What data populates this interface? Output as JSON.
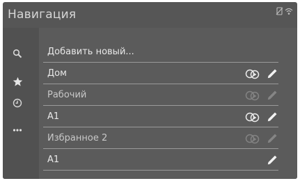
{
  "header": {
    "title": "Навигация",
    "status_icons": [
      "phone-off-icon",
      "wifi-icon"
    ]
  },
  "rail": {
    "items": [
      {
        "icon": "search-icon"
      },
      {
        "icon": "star-icon",
        "active": true
      },
      {
        "icon": "history-icon"
      },
      {
        "icon": "more-icon"
      }
    ]
  },
  "list": {
    "items": [
      {
        "label": "Добавить новый...",
        "actions": []
      },
      {
        "label": "Дом",
        "actions": [
          "connect-icon",
          "edit-icon"
        ],
        "enabled": true
      },
      {
        "label": "Рабочий",
        "actions": [
          "connect-icon",
          "edit-icon"
        ],
        "enabled": false
      },
      {
        "label": "A1",
        "actions": [
          "connect-icon",
          "edit-icon"
        ],
        "enabled": true
      },
      {
        "label": "Избранное 2",
        "actions": [
          "connect-icon",
          "edit-icon"
        ],
        "enabled": false
      },
      {
        "label": "A1",
        "actions": [
          "edit-icon"
        ],
        "enabled": true
      }
    ]
  },
  "colors": {
    "screen_bg": "#565656",
    "text": "#e8e8e8",
    "separator": "#9a9a9a"
  }
}
